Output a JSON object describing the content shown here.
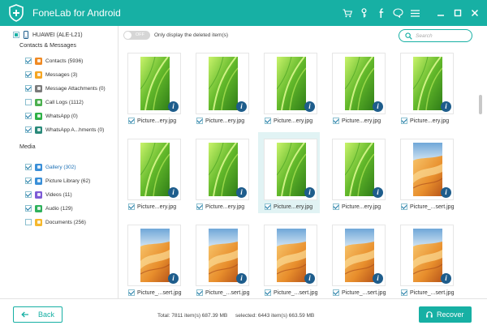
{
  "app": {
    "title": "FoneLab for Android"
  },
  "device": {
    "name": "HUAWEI (ALE-L21)"
  },
  "sidebar": {
    "sections": [
      {
        "label": "Contacts & Messages",
        "items": [
          {
            "label": "Contacts (5936)",
            "checked": true,
            "icon": "contacts-icon",
            "color": "#f08a24"
          },
          {
            "label": "Messages (3)",
            "checked": true,
            "icon": "messages-icon",
            "color": "#f5a623"
          },
          {
            "label": "Message Attachments (0)",
            "checked": true,
            "icon": "attachment-icon",
            "color": "#7a7a7a"
          },
          {
            "label": "Call Logs (1112)",
            "checked": false,
            "icon": "call-logs-icon",
            "color": "#4cb050"
          },
          {
            "label": "WhatsApp (0)",
            "checked": true,
            "icon": "whatsapp-icon",
            "color": "#2fb147"
          },
          {
            "label": "WhatsApp A...hments (0)",
            "checked": true,
            "icon": "whatsapp-attachments-icon",
            "color": "#2a8a7a"
          }
        ]
      },
      {
        "label": "Media",
        "items": [
          {
            "label": "Gallery (302)",
            "checked": true,
            "active": true,
            "icon": "gallery-icon",
            "color": "#3a8fd8"
          },
          {
            "label": "Picture Library (62)",
            "checked": true,
            "icon": "picture-library-icon",
            "color": "#3a8fd8"
          },
          {
            "label": "Videos (11)",
            "checked": true,
            "icon": "videos-icon",
            "color": "#7d5bd6"
          },
          {
            "label": "Audio (129)",
            "checked": true,
            "icon": "audio-icon",
            "color": "#2fb15c"
          },
          {
            "label": "Documents (256)",
            "checked": false,
            "icon": "documents-icon",
            "color": "#f5b82e"
          }
        ]
      }
    ]
  },
  "toolbar": {
    "toggle_state": "OFF",
    "toggle_desc": "Only display the deleted item(s)",
    "search_placeholder": "Search"
  },
  "grid": {
    "columns": 5,
    "selected_index": 7,
    "items": [
      {
        "name": "Picture...ery.jpg",
        "image": "green-leaf",
        "checked": true
      },
      {
        "name": "Picture...ery.jpg",
        "image": "green-leaf",
        "checked": true
      },
      {
        "name": "Picture...ery.jpg",
        "image": "green-leaf",
        "checked": true
      },
      {
        "name": "Picture...ery.jpg",
        "image": "green-leaf",
        "checked": true
      },
      {
        "name": "Picture...ery.jpg",
        "image": "green-leaf",
        "checked": true
      },
      {
        "name": "Picture...ery.jpg",
        "image": "green-leaf",
        "checked": true
      },
      {
        "name": "Picture...ery.jpg",
        "image": "green-leaf",
        "checked": true
      },
      {
        "name": "Picture...ery.jpg",
        "image": "green-leaf",
        "checked": true
      },
      {
        "name": "Picture...ery.jpg",
        "image": "green-leaf",
        "checked": true
      },
      {
        "name": "Picture_...sert.jpg",
        "image": "desert",
        "checked": true
      },
      {
        "name": "Picture_...sert.jpg",
        "image": "desert",
        "checked": true
      },
      {
        "name": "Picture_...sert.jpg",
        "image": "desert",
        "checked": true
      },
      {
        "name": "Picture_...sert.jpg",
        "image": "desert",
        "checked": true
      },
      {
        "name": "Picture_...sert.jpg",
        "image": "desert",
        "checked": true
      },
      {
        "name": "Picture_...sert.jpg",
        "image": "desert",
        "checked": true
      }
    ]
  },
  "footer": {
    "back_label": "Back",
    "total": "Total: 7811 item(s) 687.39 MB",
    "selected": "selected: 6443 item(s) 663.59 MB",
    "recover_label": "Recover"
  },
  "colors": {
    "accent": "#17b0a4",
    "info": "#1e5d8c",
    "link": "#1b6fb5"
  }
}
